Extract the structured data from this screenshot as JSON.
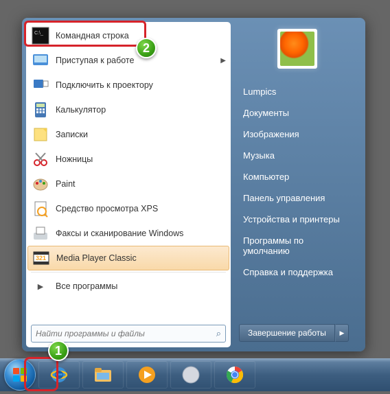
{
  "left_menu": [
    {
      "label": "Командная строка",
      "icon": "cmd"
    },
    {
      "label": "Приступая к работе",
      "icon": "getting-started",
      "submenu": true
    },
    {
      "label": "Подключить к проектору",
      "icon": "projector"
    },
    {
      "label": "Калькулятор",
      "icon": "calculator"
    },
    {
      "label": "Записки",
      "icon": "sticky-notes"
    },
    {
      "label": "Ножницы",
      "icon": "snipping"
    },
    {
      "label": "Paint",
      "icon": "paint"
    },
    {
      "label": "Средство просмотра XPS",
      "icon": "xps-viewer"
    },
    {
      "label": "Факсы и сканирование Windows",
      "icon": "fax-scan"
    },
    {
      "label": "Media Player Classic",
      "icon": "mpc",
      "selected": true
    }
  ],
  "all_programs_label": "Все программы",
  "search": {
    "placeholder": "Найти программы и файлы"
  },
  "right_menu": [
    "Lumpics",
    "Документы",
    "Изображения",
    "Музыка",
    "Компьютер",
    "Панель управления",
    "Устройства и принтеры",
    "Программы по умолчанию",
    "Справка и поддержка"
  ],
  "shutdown_label": "Завершение работы",
  "badges": {
    "one": "1",
    "two": "2"
  }
}
